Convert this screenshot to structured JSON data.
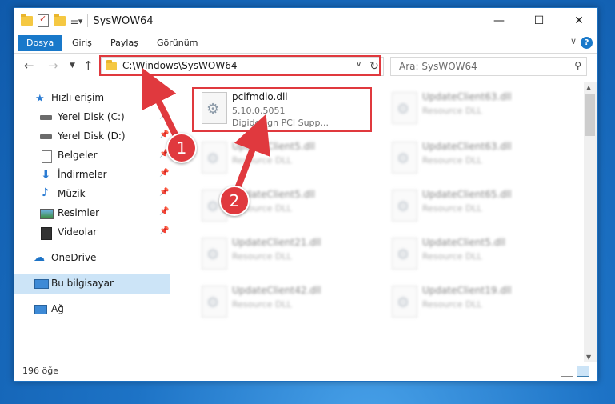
{
  "window": {
    "title": "SysWOW64"
  },
  "ribbon": {
    "tabs": [
      "Dosya",
      "Giriş",
      "Paylaş",
      "Görünüm"
    ]
  },
  "address": {
    "path": "C:\\Windows\\SysWOW64",
    "search_placeholder": "Ara: SysWOW64"
  },
  "nav": {
    "items": [
      {
        "label": "Hızlı erişim",
        "icon": "star-icon"
      },
      {
        "label": "Yerel Disk (C:)",
        "icon": "drive-icon",
        "pinned": true
      },
      {
        "label": "Yerel Disk (D:)",
        "icon": "drive-icon",
        "pinned": true
      },
      {
        "label": "Belgeler",
        "icon": "documents-icon",
        "pinned": true
      },
      {
        "label": "İndirmeler",
        "icon": "download-icon",
        "pinned": true
      },
      {
        "label": "Müzik",
        "icon": "music-icon",
        "pinned": true
      },
      {
        "label": "Resimler",
        "icon": "pictures-icon",
        "pinned": true
      },
      {
        "label": "Videolar",
        "icon": "videos-icon",
        "pinned": true
      },
      {
        "label": "OneDrive",
        "icon": "cloud-icon"
      },
      {
        "label": "Bu bilgisayar",
        "icon": "computer-icon",
        "selected": true
      },
      {
        "label": "Ağ",
        "icon": "network-icon"
      }
    ]
  },
  "files": [
    {
      "name": "pcifmdio.dll",
      "line2": "5.10.0.5051",
      "line3": "Digidesign PCI Supp...",
      "highlighted": true
    },
    {
      "name": "UpdateClient63.dll",
      "line2": "Resource DLL"
    },
    {
      "name": "UpdateClient5.dll",
      "line2": "Resource DLL"
    },
    {
      "name": "UpdateClient63.dll",
      "line2": "Resource DLL"
    },
    {
      "name": "UpdateClient5.dll",
      "line2": "Resource DLL"
    },
    {
      "name": "UpdateClient65.dll",
      "line2": "Resource DLL"
    },
    {
      "name": "UpdateClient21.dll",
      "line2": "Resource DLL"
    },
    {
      "name": "UpdateClient5.dll",
      "line2": "Resource DLL"
    },
    {
      "name": "UpdateClient42.dll",
      "line2": "Resource DLL"
    },
    {
      "name": "UpdateClient19.dll",
      "line2": "Resource DLL"
    }
  ],
  "status": {
    "count": "196 öğe"
  },
  "annotations": {
    "step1": "1",
    "step2": "2",
    "color": "#e0393e"
  }
}
